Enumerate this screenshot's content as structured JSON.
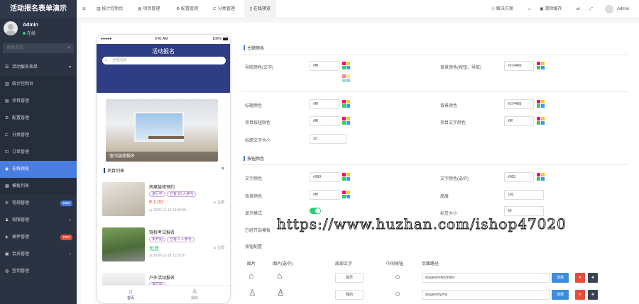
{
  "sidebar": {
    "brand": "活动报名表单演示",
    "user": {
      "name": "Admin",
      "status": "在线"
    },
    "search_placeholder": "搜索菜单",
    "items": [
      {
        "label": "活动报名表单",
        "icon": "bars-icon",
        "chevron": "▾"
      },
      {
        "label": "统计控制台",
        "icon": "chart-icon",
        "sub": true
      },
      {
        "label": "项目管理",
        "icon": "list-icon",
        "sub": true
      },
      {
        "label": "配置管理",
        "icon": "gear-icon",
        "sub": true
      },
      {
        "label": "分类管理",
        "icon": "tag-icon",
        "sub": true
      },
      {
        "label": "订单管理",
        "icon": "cart-icon",
        "sub": true
      },
      {
        "label": "在线预览",
        "icon": "eye-icon",
        "sub": true,
        "active": true
      },
      {
        "label": "模板列表",
        "icon": "grid-icon",
        "sub": true
      },
      {
        "label": "常规管理",
        "icon": "cog-icon",
        "badge": "new",
        "badge_color": "#4a7de0"
      },
      {
        "label": "权限管理",
        "icon": "users-icon",
        "chevron": "‹"
      },
      {
        "label": "插件管理",
        "icon": "plug-icon",
        "badge": "new",
        "badge_color": "#e74c3c"
      },
      {
        "label": "会员管理",
        "icon": "member-icon",
        "chevron": "‹"
      },
      {
        "label": "签到管理",
        "icon": "pin-icon"
      }
    ]
  },
  "topbar": {
    "tabs": [
      "统计控制台",
      "项目管理",
      "配置管理",
      "分类管理",
      "在线预览"
    ],
    "right": [
      "解决方案",
      "清除缓存",
      "Admin"
    ]
  },
  "phone": {
    "status": {
      "left": "●●●●●",
      "time": "9:41 AM",
      "battery": "100%"
    },
    "title": "活动报名",
    "search_placeholder": "全部活动",
    "banner_caption": "室内装修报名",
    "section_title": "项目列表",
    "items": [
      {
        "name": "房屋装修预约",
        "tags": [
          "进行中",
          "已有 10 人参与"
        ],
        "price": "¥ 1.00",
        "price_color": "#e74c3c",
        "button": "立即",
        "date": "2020-12-18 14:00:00"
      },
      {
        "name": "驾校考试报名",
        "tags": [
          "未开始",
          "已有 0 人参与"
        ],
        "price": "免费",
        "price_color": "#2ecc71",
        "button": "立即",
        "date": "2020-12-18 11:26:07"
      },
      {
        "name": "户外活动报名",
        "tags": [
          "进行中"
        ],
        "price": "",
        "price_color": "#e74c3c",
        "button": "",
        "date": ""
      }
    ],
    "tabbar": [
      {
        "label": "首页",
        "icon": "home-icon"
      },
      {
        "label": "我的",
        "icon": "user-icon"
      }
    ]
  },
  "form": {
    "sections": [
      "主题颜色",
      "按钮颜色",
      "底部导航"
    ],
    "theme": {
      "title_color_label": "导航颜色(文字)",
      "title_color_value": "#fff",
      "bg_color_label": "背景颜色(按钮、导航)",
      "bg_color_value": "#374486"
    },
    "buttons": {
      "btn_color_label": "标题颜色",
      "btn_color_value": "#fff",
      "btn_bg_label": "背景颜色",
      "btn_bg_value": "#374486",
      "join_text_label": "项目按钮颜色",
      "join_text_value": "#fff",
      "join_text2_label": "项目文字颜色",
      "join_text2_value": "#fff",
      "size_label": "标题文字大小",
      "size_value": "32"
    },
    "nav": {
      "text_color_label": "文字颜色",
      "text_color_value": "#999",
      "text_active_label": "文字颜色(选中)",
      "text_active_value": "#000",
      "bg_label": "背景颜色",
      "bg_value": "#fff",
      "height_label": "高度",
      "height_value": "100",
      "show_label": "显示模式",
      "font_size_label": "标签大小",
      "font_size_value": "40",
      "icon_label": "已经开启模板",
      "columns_label": "按钮配置",
      "headers": [
        "图片",
        "图片(选中)",
        "底部文字",
        "中间按钮",
        "页面路径"
      ],
      "rows": [
        {
          "text": "首页",
          "path": "/pages/index/index",
          "icon": "home-icon"
        },
        {
          "text": "我的",
          "path": "/pages/my/my",
          "icon": "user-icon"
        }
      ],
      "select_label": "选择"
    }
  },
  "watermark": "https://www.huzhan.com/ishop47020",
  "colors": {
    "sidebar": "#2b3343",
    "accent": "#4a7de0",
    "phone_header": "#2f3d85",
    "success": "#2ecc71",
    "danger": "#e74c3c"
  }
}
